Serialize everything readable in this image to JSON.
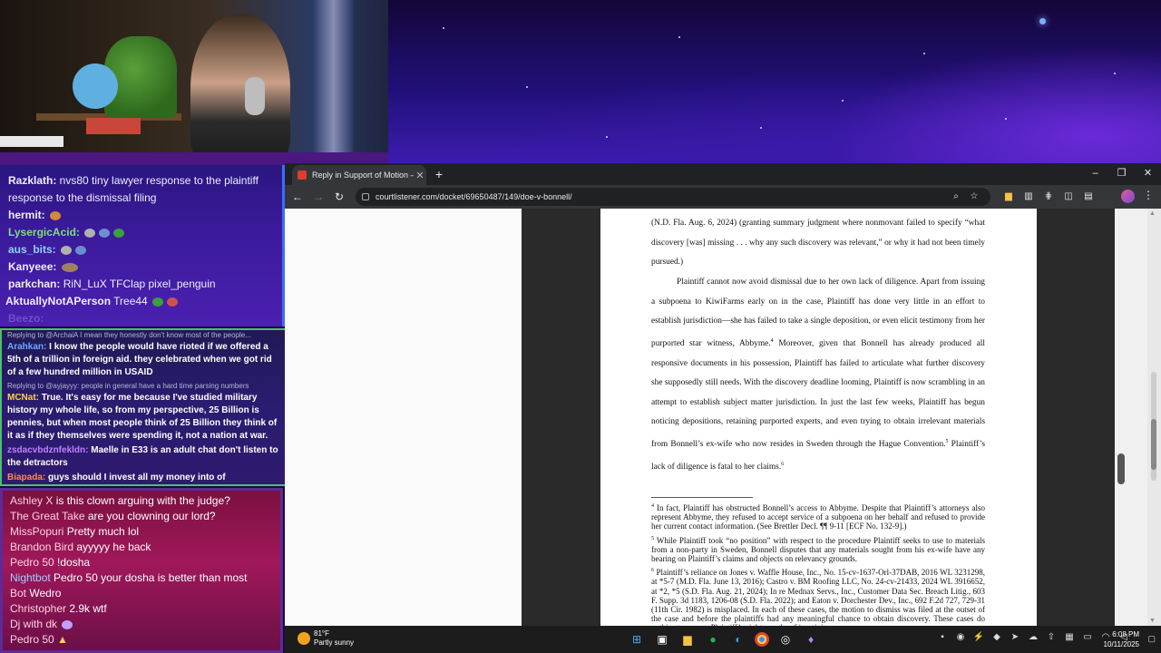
{
  "chat_top": {
    "lines": [
      {
        "user": "Razklath:",
        "text": " nvs80 tiny lawyer response to the plaintiff response to the dismissal filing",
        "color": "#ffffff"
      },
      {
        "user": "hermit:",
        "text": "",
        "color": "#ffffff"
      },
      {
        "user": "LysergicAcid:",
        "text": "",
        "color": "#7be07b"
      },
      {
        "user": "aus_bits:",
        "text": "",
        "color": "#8fd0ff"
      },
      {
        "user": "Kanyeee:",
        "text": "",
        "color": "#ffffff"
      },
      {
        "user": "parkchan:",
        "text": " RiN_LuX TFClap pixel_penguin",
        "color": "#ffffff"
      },
      {
        "user": "AktuallyNotAPerson",
        "text": " Tree44",
        "color": "#ffffff"
      },
      {
        "user": "Beezo:",
        "text": "",
        "color": "#c0a0ff"
      }
    ]
  },
  "chat_mid": {
    "reply1": "Replying to @ArchaiA I mean they honestly don't know most of the people...",
    "msg1_user": "Arahkan:",
    "msg1_text": " I know the people would have rioted if we offered a 5th of a trillion in foreign aid. they celebrated when we got rid of a few hundred million in USAID",
    "reply2": "Replying to @ayjayyy: people in general have a hard time parsing numbers",
    "msg2_user": "MCNat:",
    "msg2_text": " True. It's easy for me because I've studied military history my whole life, so from my perspective, 25 Billion is pennies, but when most people think of 25 Billion they think of it as if they themselves were spending it, not a nation at war.",
    "msg3_user": "zsdacvbdznfekldn:",
    "msg3_text": " Maelle in E33 is an adult chat don't listen to the detractors",
    "msg4_user": "Biapada:",
    "msg4_text": " guys should I invest all my money into of"
  },
  "chat_bot": {
    "lines": [
      {
        "user": "Ashley X",
        "text": " is this clown arguing with the judge?"
      },
      {
        "user": "The Great Take",
        "text": " are you clowning our lord?"
      },
      {
        "user": "MissPopuri",
        "text": " Pretty much lol"
      },
      {
        "user": "Brandon Bird",
        "text": " ayyyyy he back"
      },
      {
        "user": "Pedro 50",
        "text": " !dosha"
      },
      {
        "user": "Nightbot",
        "text": " Pedro 50 your dosha is better than most"
      },
      {
        "user": "Bot",
        "text": " Wedro"
      },
      {
        "user": "Christopher",
        "text": " 2.9k wtf"
      },
      {
        "user": "Dj with dk",
        "text": ""
      },
      {
        "user": "Pedro 50",
        "text": ""
      }
    ]
  },
  "browser": {
    "tab_title": "Reply in Support of Motion – #",
    "url": "courtlistener.com/docket/69650487/149/doe-v-bonnell/",
    "minimize": "–",
    "maximize": "❐",
    "close": "✕"
  },
  "pdf": {
    "para1": "(N.D. Fla. Aug. 6, 2024) (granting summary judgment where nonmovant failed to specify “what discovery [was] missing . . . why any such discovery was relevant,” or why it had not been timely pursued.)",
    "para2": "Plaintiff cannot now avoid dismissal due to her own lack of diligence. Apart from issuing a subpoena to KiwiFarms early on in the case, Plaintiff has done very little in an effort to establish jurisdiction—she has failed to take a single deposition, or even elicit testimony from her purported star witness, Abbyme.",
    "para2_fn": "4",
    "para2b": " Moreover, given that Bonnell has already produced all responsive documents in his possession, Plaintiff has failed to articulate what further discovery she supposedly still needs. With the discovery deadline looming, Plaintiff is now scrambling in an attempt to establish subject matter jurisdiction. In just the last few weeks, Plaintiff has begun noticing depositions, retaining purported experts, and even trying to obtain irrelevant materials from Bonnell’s ex-wife who now resides in Sweden through the Hague Convention.",
    "para2b_fn": "5",
    "para2c": " Plaintiff’s lack of diligence is fatal to her claims.",
    "para2c_fn": "6",
    "fn4_num": "4",
    "fn4": " In fact, Plaintiff has obstructed Bonnell’s access to Abbyme. Despite that Plaintiff’s attorneys also represent Abbyme, they refused to accept service of a subpoena on her behalf and refused to provide her current contact information. (See Brettler Decl. ¶¶ 9-11 [ECF No. 132-9].)",
    "fn5_num": "5",
    "fn5": " While Plaintiff took “no position” with respect to the procedure Plaintiff seeks to use to materials from a non-party in Sweden, Bonnell disputes that any materials sought from his ex-wife have any bearing on Plaintiff’s claims and objects on relevancy grounds.",
    "fn6_num": "6",
    "fn6": " Plaintiff’s reliance on Jones v. Waffle House, Inc., No. 15-cv-1637-Orl-37DAB, 2016 WL 3231298, at *5-7 (M.D. Fla. June 13, 2016); Castro v. BM Roofing LLC, No. 24-cv-21433, 2024 WL 3916652, at *2, *5 (S.D. Fla. Aug. 21, 2024); In re Mednax Servs., Inc., Customer Data Sec. Breach Litig., 603 F. Supp. 3d 1183, 1206-08 (S.D. Fla. 2022); and Eaton v. Dorchester Dev., Inc., 692 F.2d 727, 729-31 (11th Cir. 1982) is misplaced. In each of these cases, the motion to dismiss was filed at the outset of the case and before the plaintiffs had any meaningful chance to obtain discovery. These cases do nothing to excuse Plaintiff’s eight months of inactivity."
  },
  "taskbar": {
    "temp": "81°F",
    "condition": "Partly sunny",
    "time": "6:08 PM",
    "date": "10/11/2025"
  }
}
